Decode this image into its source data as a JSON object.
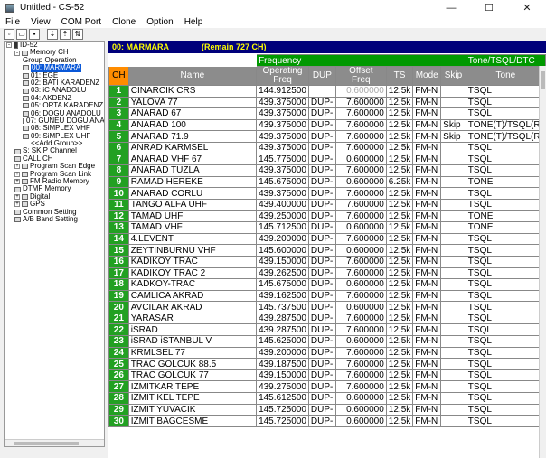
{
  "window": {
    "title": "Untitled - CS-52",
    "minimize": "—",
    "maximize": "☐",
    "close": "✕"
  },
  "menu": [
    "File",
    "View",
    "COM Port",
    "Clone",
    "Option",
    "Help"
  ],
  "toolbar": [
    "new",
    "open",
    "save",
    "read-from-radio",
    "write-to-radio",
    "clone"
  ],
  "tree": [
    {
      "label": "ID-52",
      "indent": 0,
      "exp": "-",
      "icon": "radio"
    },
    {
      "label": "Memory CH",
      "indent": 1,
      "exp": "-",
      "icon": "folder"
    },
    {
      "label": "Group Operation",
      "indent": 2,
      "exp": "",
      "icon": ""
    },
    {
      "label": "00: MARMARA",
      "indent": 2,
      "exp": "",
      "icon": "grid",
      "selected": true
    },
    {
      "label": "01: EGE",
      "indent": 2,
      "exp": "",
      "icon": "grid"
    },
    {
      "label": "02: BATI KARADENZ",
      "indent": 2,
      "exp": "",
      "icon": "grid"
    },
    {
      "label": "03: iC ANADOLU",
      "indent": 2,
      "exp": "",
      "icon": "grid"
    },
    {
      "label": "04: AKDENZ",
      "indent": 2,
      "exp": "",
      "icon": "grid"
    },
    {
      "label": "05: ORTA KARADENZ",
      "indent": 2,
      "exp": "",
      "icon": "grid"
    },
    {
      "label": "06: DOGU ANADOLU",
      "indent": 2,
      "exp": "",
      "icon": "grid"
    },
    {
      "label": "07: GUNEU DOGU ANA",
      "indent": 2,
      "exp": "",
      "icon": "grid"
    },
    {
      "label": "08: SiMPLEX VHF",
      "indent": 2,
      "exp": "",
      "icon": "grid"
    },
    {
      "label": "09: SiMPLEX UHF",
      "indent": 2,
      "exp": "",
      "icon": "grid"
    },
    {
      "label": "<<Add Group>>",
      "indent": 3,
      "exp": "",
      "icon": ""
    },
    {
      "label": "S: SKIP Channel",
      "indent": 1,
      "exp": "",
      "icon": "grid"
    },
    {
      "label": "CALL CH",
      "indent": 1,
      "exp": "",
      "icon": "grid"
    },
    {
      "label": "Program Scan Edge",
      "indent": 1,
      "exp": "+",
      "icon": "folder"
    },
    {
      "label": "Program Scan Link",
      "indent": 1,
      "exp": "+",
      "icon": "folder"
    },
    {
      "label": "FM Radio Memory",
      "indent": 1,
      "exp": "+",
      "icon": "folder"
    },
    {
      "label": "DTMF Memory",
      "indent": 1,
      "exp": "",
      "icon": "grid"
    },
    {
      "label": "Digital",
      "indent": 1,
      "exp": "+",
      "icon": "folder"
    },
    {
      "label": "GPS",
      "indent": 1,
      "exp": "+",
      "icon": "folder"
    },
    {
      "label": "Common Setting",
      "indent": 1,
      "exp": "",
      "icon": "grid"
    },
    {
      "label": "A/B Band Setting",
      "indent": 1,
      "exp": "",
      "icon": "grid"
    }
  ],
  "pane": {
    "group": "00: MARMARA",
    "remain": "(Remain  727 CH)"
  },
  "groups": {
    "frequency": "Frequency",
    "tone": "Tone/TSQL/DTC"
  },
  "columns": {
    "ch": "CH",
    "name": "Name",
    "freq_line1": "Operating",
    "freq_line2": "Freq",
    "dup": "DUP",
    "off_line1": "Offset",
    "off_line2": "Freq",
    "ts": "TS",
    "mode": "Mode",
    "skip": "Skip",
    "tone": "Tone"
  },
  "rows": [
    {
      "ch": "1",
      "name": "CINARCIK CRS",
      "freq": "144.912500",
      "dup": "",
      "offset": "0.600000",
      "ts": "12.5k",
      "mode": "FM-N",
      "skip": "",
      "tone": "TSQL",
      "dim": true
    },
    {
      "ch": "2",
      "name": "YALOVA 77",
      "freq": "439.375000",
      "dup": "DUP-",
      "offset": "7.600000",
      "ts": "12.5k",
      "mode": "FM-N",
      "skip": "",
      "tone": "TSQL"
    },
    {
      "ch": "3",
      "name": "ANARAD 67",
      "freq": "439.375000",
      "dup": "DUP-",
      "offset": "7.600000",
      "ts": "12.5k",
      "mode": "FM-N",
      "skip": "",
      "tone": "TSQL"
    },
    {
      "ch": "4",
      "name": "ANARAD 100",
      "freq": "439.375000",
      "dup": "DUP-",
      "offset": "7.600000",
      "ts": "12.5k",
      "mode": "FM-N",
      "skip": "Skip",
      "tone": "TONE(T)/TSQL(R)"
    },
    {
      "ch": "5",
      "name": "ANARAD 71.9",
      "freq": "439.375000",
      "dup": "DUP-",
      "offset": "7.600000",
      "ts": "12.5k",
      "mode": "FM-N",
      "skip": "Skip",
      "tone": "TONE(T)/TSQL(R)"
    },
    {
      "ch": "6",
      "name": "ANRAD KARMSEL",
      "freq": "439.375000",
      "dup": "DUP-",
      "offset": "7.600000",
      "ts": "12.5k",
      "mode": "FM-N",
      "skip": "",
      "tone": "TSQL"
    },
    {
      "ch": "7",
      "name": "ANARAD VHF 67",
      "freq": "145.775000",
      "dup": "DUP-",
      "offset": "0.600000",
      "ts": "12.5k",
      "mode": "FM-N",
      "skip": "",
      "tone": "TSQL"
    },
    {
      "ch": "8",
      "name": "ANARAD TUZLA",
      "freq": "439.375000",
      "dup": "DUP-",
      "offset": "7.600000",
      "ts": "12.5k",
      "mode": "FM-N",
      "skip": "",
      "tone": "TSQL"
    },
    {
      "ch": "9",
      "name": "RAMAD HEREKE",
      "freq": "145.675000",
      "dup": "DUP-",
      "offset": "0.600000",
      "ts": "6.25k",
      "mode": "FM-N",
      "skip": "",
      "tone": "TONE"
    },
    {
      "ch": "10",
      "name": "ANARAD CORLU",
      "freq": "439.375000",
      "dup": "DUP-",
      "offset": "7.600000",
      "ts": "12.5k",
      "mode": "FM-N",
      "skip": "",
      "tone": "TSQL"
    },
    {
      "ch": "11",
      "name": "TANGO ALFA UHF",
      "freq": "439.400000",
      "dup": "DUP-",
      "offset": "7.600000",
      "ts": "12.5k",
      "mode": "FM-N",
      "skip": "",
      "tone": "TSQL"
    },
    {
      "ch": "12",
      "name": "TAMAD UHF",
      "freq": "439.250000",
      "dup": "DUP-",
      "offset": "7.600000",
      "ts": "12.5k",
      "mode": "FM-N",
      "skip": "",
      "tone": "TONE"
    },
    {
      "ch": "13",
      "name": "TAMAD VHF",
      "freq": "145.712500",
      "dup": "DUP-",
      "offset": "0.600000",
      "ts": "12.5k",
      "mode": "FM-N",
      "skip": "",
      "tone": "TONE"
    },
    {
      "ch": "14",
      "name": "4.LEVENT",
      "freq": "439.200000",
      "dup": "DUP-",
      "offset": "7.600000",
      "ts": "12.5k",
      "mode": "FM-N",
      "skip": "",
      "tone": "TSQL"
    },
    {
      "ch": "15",
      "name": "ZEYTINBURNU VHF",
      "freq": "145.600000",
      "dup": "DUP-",
      "offset": "0.600000",
      "ts": "12.5k",
      "mode": "FM-N",
      "skip": "",
      "tone": "TSQL"
    },
    {
      "ch": "16",
      "name": "KADIKOY TRAC",
      "freq": "439.150000",
      "dup": "DUP-",
      "offset": "7.600000",
      "ts": "12.5k",
      "mode": "FM-N",
      "skip": "",
      "tone": "TSQL"
    },
    {
      "ch": "17",
      "name": "KADIKOY TRAC 2",
      "freq": "439.262500",
      "dup": "DUP-",
      "offset": "7.600000",
      "ts": "12.5k",
      "mode": "FM-N",
      "skip": "",
      "tone": "TSQL"
    },
    {
      "ch": "18",
      "name": "KADKOY-TRAC",
      "freq": "145.675000",
      "dup": "DUP-",
      "offset": "0.600000",
      "ts": "12.5k",
      "mode": "FM-N",
      "skip": "",
      "tone": "TSQL"
    },
    {
      "ch": "19",
      "name": "CAMLICA AKRAD",
      "freq": "439.162500",
      "dup": "DUP-",
      "offset": "7.600000",
      "ts": "12.5k",
      "mode": "FM-N",
      "skip": "",
      "tone": "TSQL"
    },
    {
      "ch": "20",
      "name": "AVCILAR AKRAD",
      "freq": "145.737500",
      "dup": "DUP-",
      "offset": "0.600000",
      "ts": "12.5k",
      "mode": "FM-N",
      "skip": "",
      "tone": "TSQL"
    },
    {
      "ch": "21",
      "name": "YARASAR",
      "freq": "439.287500",
      "dup": "DUP-",
      "offset": "7.600000",
      "ts": "12.5k",
      "mode": "FM-N",
      "skip": "",
      "tone": "TSQL"
    },
    {
      "ch": "22",
      "name": "iSRAD",
      "freq": "439.287500",
      "dup": "DUP-",
      "offset": "7.600000",
      "ts": "12.5k",
      "mode": "FM-N",
      "skip": "",
      "tone": "TSQL"
    },
    {
      "ch": "23",
      "name": "iSRAD iSTANBUL V",
      "freq": "145.625000",
      "dup": "DUP-",
      "offset": "0.600000",
      "ts": "12.5k",
      "mode": "FM-N",
      "skip": "",
      "tone": "TSQL"
    },
    {
      "ch": "24",
      "name": "KRMLSEL 77",
      "freq": "439.200000",
      "dup": "DUP-",
      "offset": "7.600000",
      "ts": "12.5k",
      "mode": "FM-N",
      "skip": "",
      "tone": "TSQL"
    },
    {
      "ch": "25",
      "name": "TRAC GOLCUK 88.5",
      "freq": "439.187500",
      "dup": "DUP-",
      "offset": "7.600000",
      "ts": "12.5k",
      "mode": "FM-N",
      "skip": "",
      "tone": "TSQL"
    },
    {
      "ch": "26",
      "name": "TRAC GOLCUK 77",
      "freq": "439.150000",
      "dup": "DUP-",
      "offset": "7.600000",
      "ts": "12.5k",
      "mode": "FM-N",
      "skip": "",
      "tone": "TSQL"
    },
    {
      "ch": "27",
      "name": "IZMITKAR TEPE",
      "freq": "439.275000",
      "dup": "DUP-",
      "offset": "7.600000",
      "ts": "12.5k",
      "mode": "FM-N",
      "skip": "",
      "tone": "TSQL"
    },
    {
      "ch": "28",
      "name": "IZMIT KEL TEPE",
      "freq": "145.612500",
      "dup": "DUP-",
      "offset": "0.600000",
      "ts": "12.5k",
      "mode": "FM-N",
      "skip": "",
      "tone": "TSQL"
    },
    {
      "ch": "29",
      "name": "IZMIT YUVACIK",
      "freq": "145.725000",
      "dup": "DUP-",
      "offset": "0.600000",
      "ts": "12.5k",
      "mode": "FM-N",
      "skip": "",
      "tone": "TSQL"
    },
    {
      "ch": "30",
      "name": "IZMIT BAGCESME",
      "freq": "145.725000",
      "dup": "DUP-",
      "offset": "0.600000",
      "ts": "12.5k",
      "mode": "FM-N",
      "skip": "",
      "tone": "TSQL"
    }
  ]
}
